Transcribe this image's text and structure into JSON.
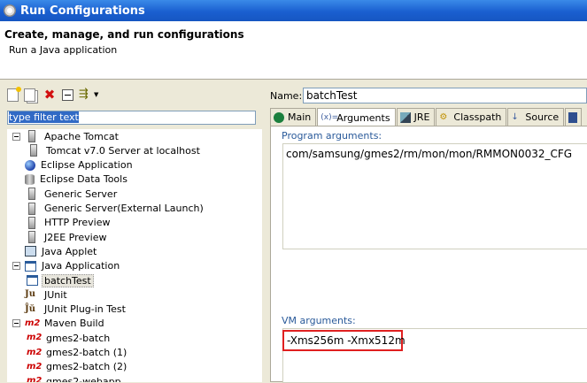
{
  "window": {
    "title": "Run Configurations"
  },
  "header": {
    "title": "Create, manage, and run configurations",
    "subtitle": "Run a Java application"
  },
  "filter": {
    "value": "type filter text"
  },
  "tree": [
    {
      "label": "Apache Tomcat",
      "icon": "server-icon",
      "level": 0,
      "expanded": true
    },
    {
      "label": "Tomcat v7.0 Server at localhost",
      "icon": "server-icon",
      "level": 1
    },
    {
      "label": "Eclipse Application",
      "icon": "globe-icon",
      "level": 0
    },
    {
      "label": "Eclipse Data Tools",
      "icon": "database-icon",
      "level": 0
    },
    {
      "label": "Generic Server",
      "icon": "server-icon",
      "level": 0
    },
    {
      "label": "Generic Server(External Launch)",
      "icon": "server-icon",
      "level": 0
    },
    {
      "label": "HTTP Preview",
      "icon": "server-icon",
      "level": 0
    },
    {
      "label": "J2EE Preview",
      "icon": "server-icon",
      "level": 0
    },
    {
      "label": "Java Applet",
      "icon": "applet-icon",
      "level": 0
    },
    {
      "label": "Java Application",
      "icon": "java-app-icon",
      "level": 0,
      "expanded": true
    },
    {
      "label": "batchTest",
      "icon": "java-app-icon",
      "level": 1,
      "selected": true
    },
    {
      "label": "JUnit",
      "icon": "junit-icon",
      "level": 0
    },
    {
      "label": "JUnit Plug-in Test",
      "icon": "junit-plugin-icon",
      "level": 0
    },
    {
      "label": "Maven Build",
      "icon": "maven-icon",
      "level": 0,
      "expanded": true
    },
    {
      "label": "gmes2-batch",
      "icon": "maven-icon",
      "level": 1
    },
    {
      "label": "gmes2-batch (1)",
      "icon": "maven-icon",
      "level": 1
    },
    {
      "label": "gmes2-batch (2)",
      "icon": "maven-icon",
      "level": 1
    },
    {
      "label": "gmes2-webapp",
      "icon": "maven-icon",
      "level": 1
    }
  ],
  "config": {
    "name_label": "Name:",
    "name_value": "batchTest",
    "tabs": [
      {
        "label": "Main",
        "icon": "main-tab-icon",
        "active": false
      },
      {
        "label": "Arguments",
        "icon": "arguments-tab-icon",
        "active": true
      },
      {
        "label": "JRE",
        "icon": "jre-tab-icon",
        "active": false
      },
      {
        "label": "Classpath",
        "icon": "classpath-tab-icon",
        "active": false
      },
      {
        "label": "Source",
        "icon": "source-tab-icon",
        "active": false
      }
    ],
    "program_args_label": "Program arguments:",
    "program_args_value": "com/samsung/gmes2/rm/mon/mon/RMMON0032_CFG",
    "vm_args_label": "VM arguments:",
    "vm_args_value": "-Xms256m -Xmx512m"
  },
  "icons": {
    "args_glyph": "(x)=",
    "classpath_glyph": "⚙",
    "source_glyph": "↓"
  },
  "colors": {
    "selection": "#316ac5",
    "highlight_box": "#e02020",
    "group_label": "#2a5a9a"
  }
}
